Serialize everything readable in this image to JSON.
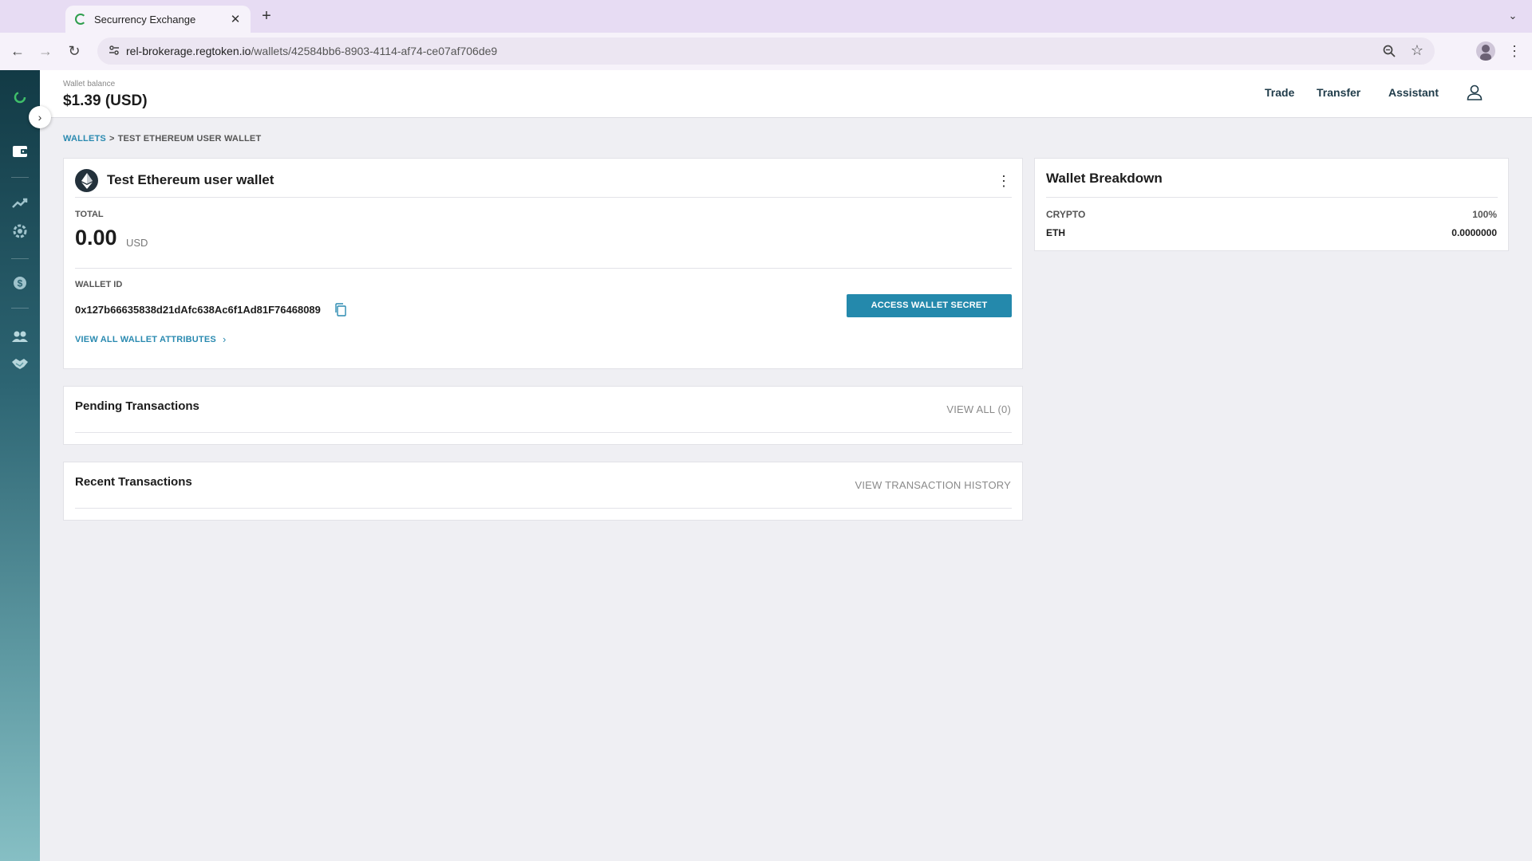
{
  "browser": {
    "tab_title": "Securrency Exchange",
    "url_host": "rel-brokerage.regtoken.io",
    "url_path": "/wallets/42584bb6-8903-4114-af74-ce07af706de9"
  },
  "header": {
    "wallet_balance_label": "Wallet balance",
    "wallet_balance_value": "$1.39 (USD)",
    "nav": [
      "Trade",
      "Transfer",
      "Assistant"
    ]
  },
  "breadcrumb": {
    "root": "WALLETS",
    "separator": ">",
    "current": "TEST ETHEREUM USER WALLET"
  },
  "wallet": {
    "title": "Test Ethereum user wallet",
    "total_label": "TOTAL",
    "total_value": "0.00",
    "total_unit": "USD",
    "id_label": "WALLET ID",
    "id_value": "0x127b66635838d21dAfc638Ac6f1Ad81F76468089",
    "view_attributes": "VIEW ALL WALLET ATTRIBUTES",
    "access_secret": "ACCESS WALLET SECRET"
  },
  "breakdown": {
    "title": "Wallet Breakdown",
    "rows": [
      {
        "label": "CRYPTO",
        "value": "100%"
      },
      {
        "label": "ETH",
        "value": "0.0000000"
      }
    ]
  },
  "pending": {
    "title": "Pending Transactions",
    "link": "VIEW ALL (0)"
  },
  "recent": {
    "title": "Recent Transactions",
    "link": "VIEW TRANSACTION HISTORY"
  },
  "colors": {
    "accent": "#2489ac",
    "link": "#2a8ab0",
    "sidebar_top": "#123a45",
    "sidebar_bottom": "#86bfc4"
  }
}
